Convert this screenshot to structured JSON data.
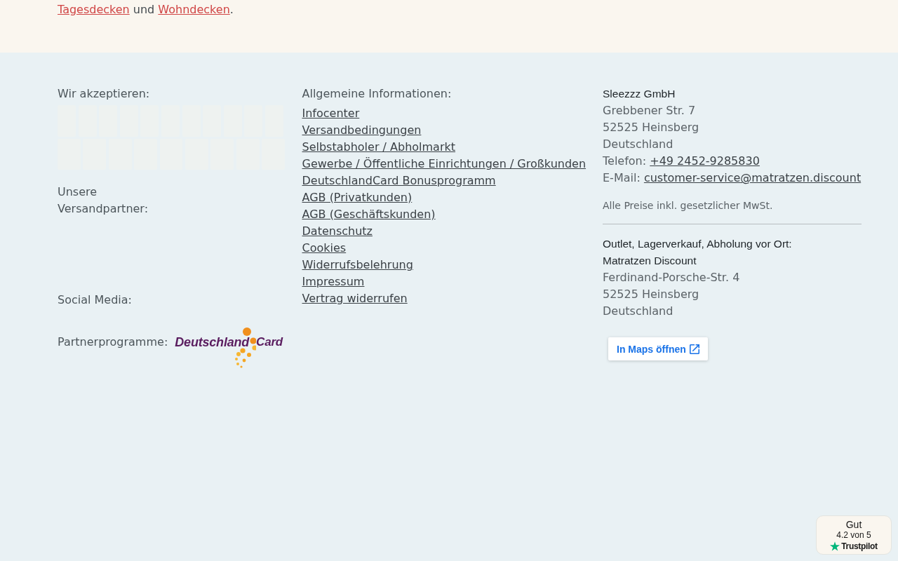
{
  "intro": {
    "parts": [
      {
        "kind": "link",
        "text": "Tagesdecken"
      },
      {
        "kind": "text",
        "text": " und "
      },
      {
        "kind": "link",
        "text": "Wohndecken"
      },
      {
        "kind": "text",
        "text": "."
      }
    ]
  },
  "payments": {
    "label": "Wir akzeptieren:"
  },
  "shipping": {
    "label": "Unsere Versandpartner:"
  },
  "social": {
    "label": "Social Media:"
  },
  "partners": {
    "label": "Partnerprogramme:",
    "logo_words": [
      "Deutschland",
      "Card"
    ]
  },
  "info": {
    "heading": "Allgemeine Informationen:",
    "links": [
      "Infocenter",
      "Versandbedingungen",
      "Selbstabholer / Abholmarkt",
      "Gewerbe / Öffentliche Einrichtungen / Großkunden",
      "DeutschlandCard Bonusprogramm",
      "AGB (Privatkunden)",
      "AGB (Geschäftskunden)",
      "Datenschutz",
      "Cookies",
      "Widerrufsbelehrung",
      "Impressum",
      "Vertrag widerrufen"
    ]
  },
  "company": {
    "name": "Sleezzz GmbH",
    "address_lines": [
      "Grebbener Str. 7",
      "52525 Heinsberg",
      "Deutschland"
    ],
    "contacts": [
      {
        "label": "Telefon:",
        "value": "+49 2452-9285830"
      },
      {
        "label": "E-Mail:",
        "value": "customer-service@matratzen.discount"
      }
    ],
    "tax_note": "Alle Preise inkl. gesetzlicher MwSt."
  },
  "outlet": {
    "heading": "Outlet, Lagerverkauf, Abholung vor Ort:",
    "name": "Matratzen Discount",
    "address_lines": [
      "Ferdinand-Porsche-Str. 4",
      "52525 Heinsberg",
      "Deutschland"
    ],
    "maps_button": "In Maps öffnen"
  },
  "trustpilot": {
    "rating_word": "Gut",
    "score": "4.2 von 5",
    "brand": "Trustpilot"
  }
}
